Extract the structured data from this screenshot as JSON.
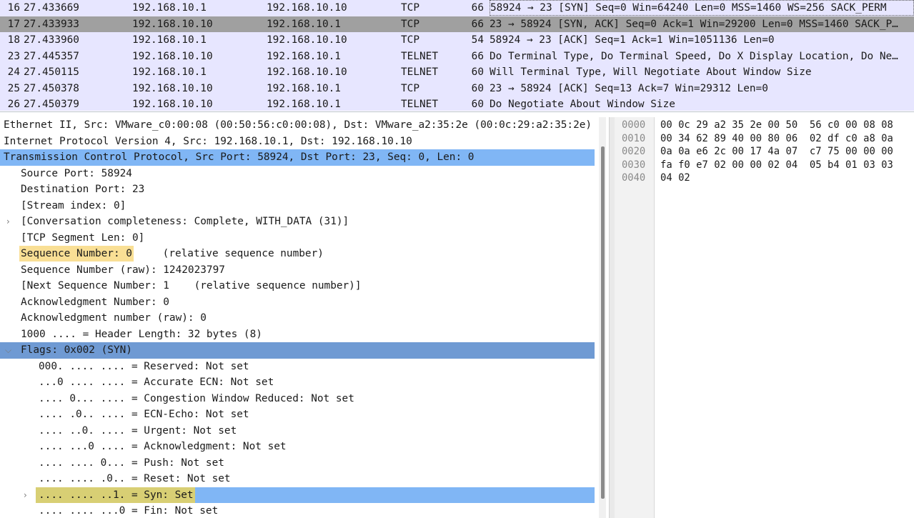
{
  "colors": {
    "tcp_row": "#e7e6ff",
    "telnet_row": "#e7e6ff",
    "selected_row": "#a0a0a0",
    "section_selected": "#80b6f5",
    "flags_selected": "#6f9ad3",
    "field_highlight": "#f9df95"
  },
  "packets": [
    {
      "no": "16",
      "time": "27.433669",
      "src": "192.168.10.1",
      "dst": "192.168.10.10",
      "proto": "TCP",
      "len": "66",
      "info": "58924 → 23 [SYN] Seq=0 Win=64240 Len=0 MSS=1460 WS=256 SACK_PERM"
    },
    {
      "no": "17",
      "time": "27.433933",
      "src": "192.168.10.10",
      "dst": "192.168.10.1",
      "proto": "TCP",
      "len": "66",
      "info": "23 → 58924 [SYN, ACK] Seq=0 Ack=1 Win=29200 Len=0 MSS=1460 SACK_P…"
    },
    {
      "no": "18",
      "time": "27.433960",
      "src": "192.168.10.1",
      "dst": "192.168.10.10",
      "proto": "TCP",
      "len": "54",
      "info": "58924 → 23 [ACK] Seq=1 Ack=1 Win=1051136 Len=0"
    },
    {
      "no": "23",
      "time": "27.445357",
      "src": "192.168.10.10",
      "dst": "192.168.10.1",
      "proto": "TELNET",
      "len": "66",
      "info": "Do Terminal Type, Do Terminal Speed, Do X Display Location, Do Ne…"
    },
    {
      "no": "24",
      "time": "27.450115",
      "src": "192.168.10.1",
      "dst": "192.168.10.10",
      "proto": "TELNET",
      "len": "60",
      "info": "Will Terminal Type, Will Negotiate About Window Size"
    },
    {
      "no": "25",
      "time": "27.450378",
      "src": "192.168.10.10",
      "dst": "192.168.10.1",
      "proto": "TCP",
      "len": "60",
      "info": "23 → 58924 [ACK] Seq=13 Ack=7 Win=29312 Len=0"
    },
    {
      "no": "26",
      "time": "27.450379",
      "src": "192.168.10.10",
      "dst": "192.168.10.1",
      "proto": "TELNET",
      "len": "60",
      "info": "Do Negotiate About Window Size"
    }
  ],
  "details": [
    {
      "text": "Ethernet II, Src: VMware_c0:00:08 (00:50:56:c0:00:08), Dst: VMware_a2:35:2e (00:0c:29:a2:35:2e)"
    },
    {
      "text": "Internet Protocol Version 4, Src: 192.168.10.1, Dst: 192.168.10.10"
    },
    {
      "text": "Transmission Control Protocol, Src Port: 58924, Dst Port: 23, Seq: 0, Len: 0"
    },
    {
      "text": "Source Port: 58924"
    },
    {
      "text": "Destination Port: 23"
    },
    {
      "text": "[Stream index: 0]"
    },
    {
      "text": "[Conversation completeness: Complete, WITH_DATA (31)]"
    },
    {
      "text": "[TCP Segment Len: 0]"
    },
    {
      "text": "Sequence Number: 0",
      "suffix": "    (relative sequence number)"
    },
    {
      "text": "Sequence Number (raw): 1242023797"
    },
    {
      "text": "[Next Sequence Number: 1    (relative sequence number)]"
    },
    {
      "text": "Acknowledgment Number: 0"
    },
    {
      "text": "Acknowledgment number (raw): 0"
    },
    {
      "text": "1000 .... = Header Length: 32 bytes (8)"
    },
    {
      "text": "Flags: 0x002 (SYN)"
    },
    {
      "text": "000. .... .... = Reserved: Not set"
    },
    {
      "text": "...0 .... .... = Accurate ECN: Not set"
    },
    {
      "text": ".... 0... .... = Congestion Window Reduced: Not set"
    },
    {
      "text": ".... .0.. .... = ECN-Echo: Not set"
    },
    {
      "text": ".... ..0. .... = Urgent: Not set"
    },
    {
      "text": ".... ...0 .... = Acknowledgment: Not set"
    },
    {
      "text": ".... .... 0... = Push: Not set"
    },
    {
      "text": ".... .... .0.. = Reset: Not set"
    },
    {
      "text": ".... .... ..1. = Syn: Set"
    },
    {
      "text": ".... .... ...0 = Fin: Not set"
    }
  ],
  "hex": [
    {
      "offset": "0000",
      "bytes": "00 0c 29 a2 35 2e 00 50  56 c0 00 08 08"
    },
    {
      "offset": "0010",
      "bytes": "00 34 62 89 40 00 80 06  02 df c0 a8 0a"
    },
    {
      "offset": "0020",
      "bytes": "0a 0a e6 2c 00 17 4a 07  c7 75 00 00 00"
    },
    {
      "offset": "0030",
      "bytes": "fa f0 e7 02 00 00 02 04  05 b4 01 03 03"
    },
    {
      "offset": "0040",
      "bytes": "04 02"
    }
  ]
}
